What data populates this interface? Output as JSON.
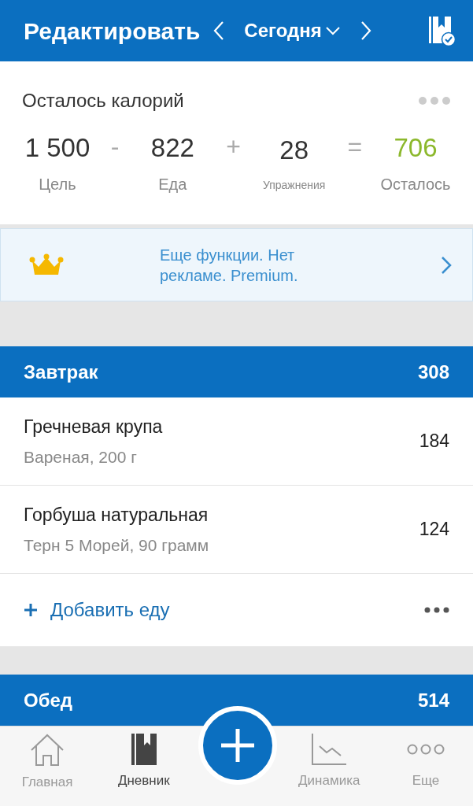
{
  "header": {
    "title": "Редактировать",
    "date": "Сегодня"
  },
  "summary": {
    "title": "Осталось калорий",
    "items": [
      {
        "kind": "value",
        "value": "1 500",
        "label": "Цель"
      },
      {
        "kind": "operator",
        "value": "-"
      },
      {
        "kind": "value",
        "value": "822",
        "label": "Еда"
      },
      {
        "kind": "operator",
        "value": "+"
      },
      {
        "kind": "value",
        "value": "28",
        "label": "Упражнения",
        "small": true
      },
      {
        "kind": "operator",
        "value": "="
      },
      {
        "kind": "value",
        "value": "706",
        "label": "Осталось",
        "highlight": true
      }
    ]
  },
  "promo": {
    "lines": [
      "Еще функции. Нет",
      "рекламе. Premium."
    ]
  },
  "meals": [
    {
      "name": "Завтрак",
      "calories": "308",
      "foods": [
        {
          "name": "Гречневая крупа",
          "detail": "Вареная, 200 г",
          "calories": "184"
        },
        {
          "name": "Горбуша натуральная",
          "detail": "Терн 5 Морей, 90 грамм",
          "calories": "124"
        }
      ],
      "add_label": "Добавить еду"
    },
    {
      "name": "Обед",
      "calories": "514"
    }
  ],
  "tabbar": [
    {
      "kind": "home",
      "label": "Главная",
      "selected": false
    },
    {
      "kind": "diary",
      "label": "Дневник",
      "selected": true
    },
    {
      "kind": "add"
    },
    {
      "kind": "progress",
      "label": "Динамика",
      "selected": false
    },
    {
      "kind": "more",
      "label": "Еще",
      "selected": false
    }
  ]
}
